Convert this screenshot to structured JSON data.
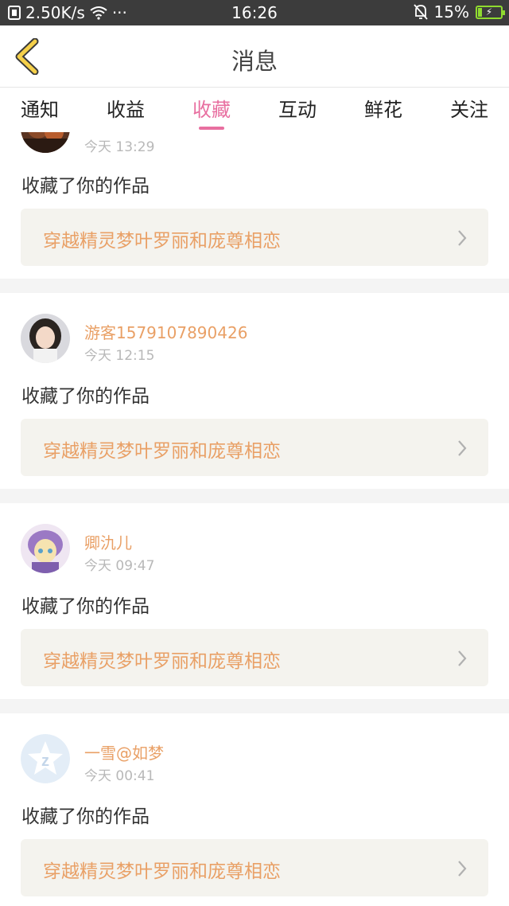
{
  "status_bar": {
    "net_speed": "2.50K/s",
    "wifi_icon": "wifi-icon",
    "more": "···",
    "time": "16:26",
    "battery_percent": "15%",
    "battery_level": 0.15,
    "mute_icon": "bell-off-icon"
  },
  "nav": {
    "back_icon": "chevron-left-icon",
    "title": "消息"
  },
  "tabs": [
    {
      "label": "通知",
      "active": false
    },
    {
      "label": "收益",
      "active": false
    },
    {
      "label": "收藏",
      "active": true
    },
    {
      "label": "互动",
      "active": false
    },
    {
      "label": "鲜花",
      "active": false
    },
    {
      "label": "关注",
      "active": false
    }
  ],
  "messages": [
    {
      "username": "",
      "time": "今天 13:29",
      "action": "收藏了你的作品",
      "work_title": "穿越精灵梦叶罗丽和庞尊相恋",
      "avatar": "user-avatar-dark"
    },
    {
      "username": "游客1579107890426",
      "time": "今天 12:15",
      "action": "收藏了你的作品",
      "work_title": "穿越精灵梦叶罗丽和庞尊相恋",
      "avatar": "user-avatar-girl-photo"
    },
    {
      "username": "卿氿儿",
      "time": "今天 09:47",
      "action": "收藏了你的作品",
      "work_title": "穿越精灵梦叶罗丽和庞尊相恋",
      "avatar": "user-avatar-anime"
    },
    {
      "username": "一雪@如梦",
      "time": "今天 00:41",
      "action": "收藏了你的作品",
      "work_title": "穿越精灵梦叶罗丽和庞尊相恋",
      "avatar": "default-qzone-avatar"
    }
  ],
  "colors": {
    "accent_pink": "#e86fa0",
    "accent_orange": "#e9a066",
    "back_yellow": "#f5c542"
  }
}
